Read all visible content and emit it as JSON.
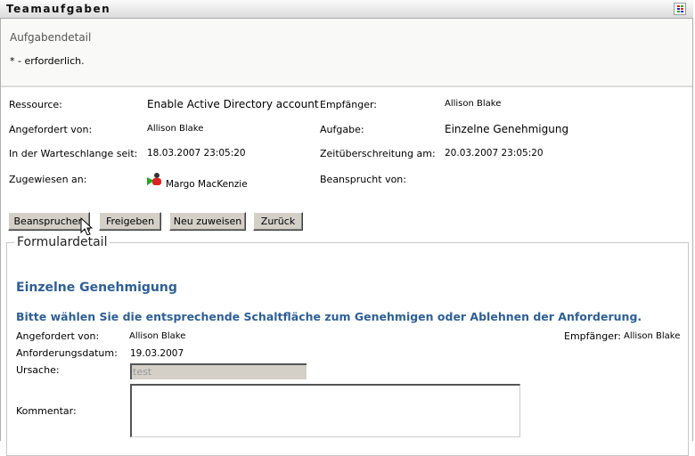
{
  "header": {
    "title": "Teamaufgaben"
  },
  "subtitle": "Aufgabendetail",
  "required_note": "* - erforderlich.",
  "details": {
    "resource_label": "Ressource:",
    "resource": "Enable Active Directory account",
    "recipient_label": "Empfänger:",
    "recipient": "Allison Blake",
    "requested_by_label": "Angefordert von:",
    "requested_by": "Allison Blake",
    "task_label": "Aufgabe:",
    "task": "Einzelne Genehmigung",
    "queued_label": "In der Warteschlange seit:",
    "queued": "18.03.2007 23:05:20",
    "timeout_label": "Zeitüberschreitung am:",
    "timeout": "20.03.2007 23:05:20",
    "assigned_label": "Zugewiesen an:",
    "assigned": "Margo MacKenzie",
    "claimed_label": "Beansprucht von:"
  },
  "buttons": {
    "claim": "Beanspruchen",
    "release": "Freigeben",
    "reassign": "Neu zuweisen",
    "back": "Zurück"
  },
  "form": {
    "legend": "Formulardetail",
    "title": "Einzelne Genehmigung",
    "instruction": "Bitte wählen Sie die entsprechende Schaltfläche zum Genehmigen oder Ablehnen der Anforderung.",
    "requested_by_label": "Angefordert von:",
    "requested_by": "Allison Blake",
    "recipient_label": "Empfänger:",
    "recipient": "Allison Blake",
    "date_label": "Anforderungsdatum:",
    "date": "19.03.2007",
    "reason_label": "Ursache:",
    "reason": "test",
    "comment_label": "Kommentar:",
    "comment": ""
  }
}
